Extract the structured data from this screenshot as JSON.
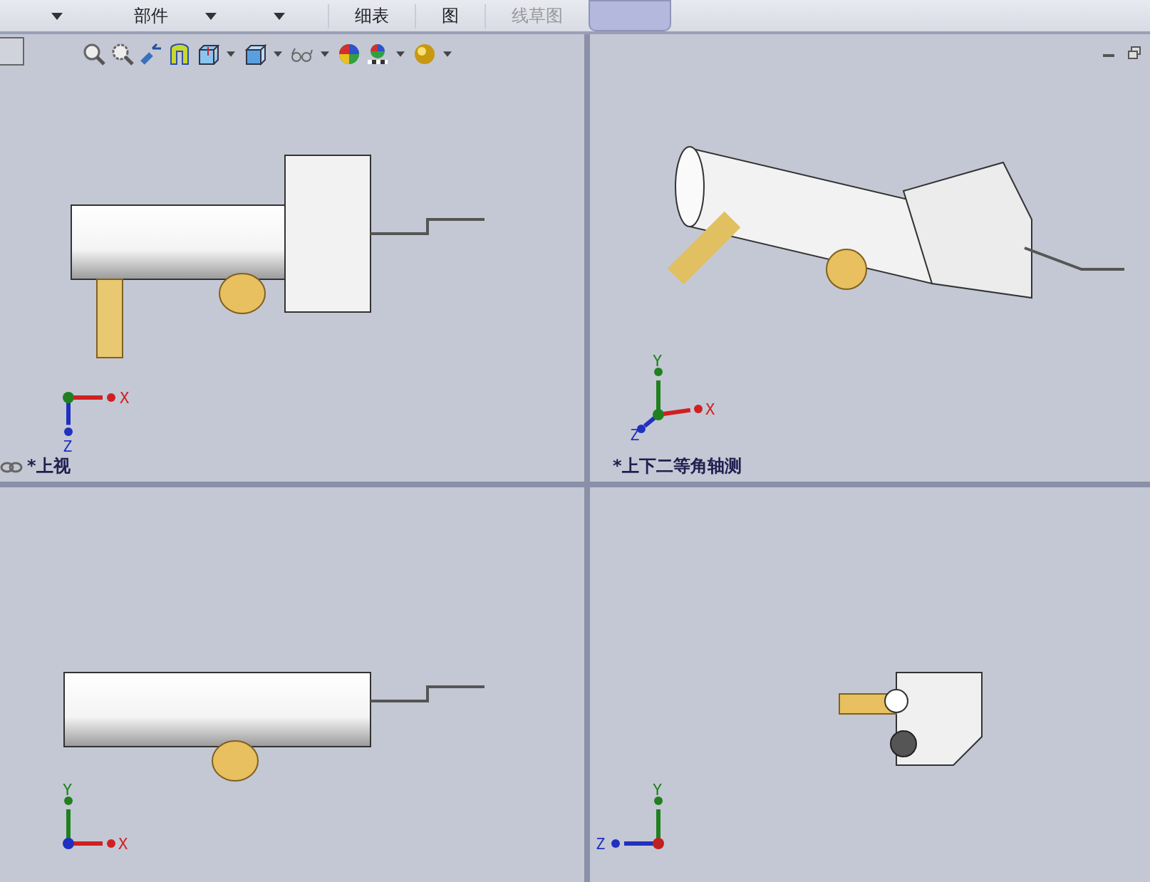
{
  "ribbon": {
    "groups": [
      {
        "label": "部件",
        "disabled": false
      },
      {
        "label": "细表",
        "disabled": false
      },
      {
        "label": "图",
        "disabled": false
      },
      {
        "label": "线草图",
        "disabled": true
      }
    ]
  },
  "viewports": [
    {
      "kind": "top",
      "label": "*上视",
      "axes": [
        {
          "label": "X"
        },
        {
          "label": "Z"
        }
      ]
    },
    {
      "kind": "iso",
      "label": "*上下二等角轴测",
      "axes": [
        {
          "label": "Y"
        },
        {
          "label": "X"
        },
        {
          "label": "Z"
        }
      ]
    },
    {
      "kind": "front",
      "axes": [
        {
          "label": "Y"
        },
        {
          "label": "X"
        }
      ]
    },
    {
      "kind": "right",
      "axes": [
        {
          "label": "Y"
        },
        {
          "label": "Z"
        }
      ]
    }
  ]
}
